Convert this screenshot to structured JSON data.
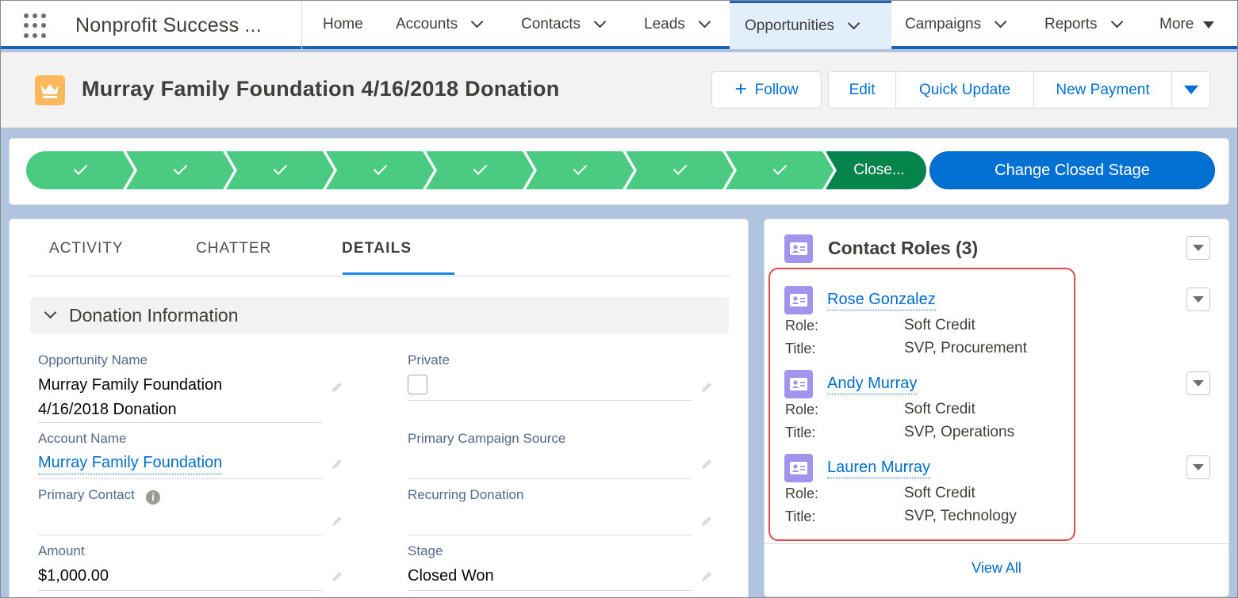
{
  "nav": {
    "app_name": "Nonprofit Success ...",
    "items": [
      {
        "label": "Home"
      },
      {
        "label": "Accounts"
      },
      {
        "label": "Contacts"
      },
      {
        "label": "Leads"
      },
      {
        "label": "Opportunities"
      },
      {
        "label": "Campaigns"
      },
      {
        "label": "Reports"
      },
      {
        "label": "More"
      }
    ],
    "active_item": "Opportunities"
  },
  "header": {
    "record_icon": "crown-icon",
    "title": "Murray Family Foundation 4/16/2018 Donation",
    "follow_label": "Follow",
    "actions": [
      "Edit",
      "Quick Update",
      "New Payment"
    ],
    "more_actions_icon": "dropdown-triangle-icon"
  },
  "path": {
    "completed_steps": 8,
    "current_step_label": "Close...",
    "change_stage_label": "Change Closed Stage",
    "colors": {
      "completed": "#4bca81",
      "current": "#04844b",
      "button": "#0070d2"
    }
  },
  "tabs": {
    "items": [
      "ACTIVITY",
      "CHATTER",
      "DETAILS"
    ],
    "active": "DETAILS"
  },
  "details": {
    "section_title": "Donation Information",
    "opportunity_name_label": "Opportunity Name",
    "opportunity_name_line1": "Murray Family Foundation",
    "opportunity_name_line2": "4/16/2018 Donation",
    "private_label": "Private",
    "private_checked": false,
    "account_name_label": "Account Name",
    "account_name_value": "Murray Family Foundation",
    "primary_campaign_label": "Primary Campaign Source",
    "primary_campaign_value": "",
    "primary_contact_label": "Primary Contact",
    "primary_contact_value": "",
    "recurring_donation_label": "Recurring Donation",
    "recurring_donation_value": "",
    "amount_label": "Amount",
    "amount_value": "$1,000.00",
    "stage_label": "Stage",
    "stage_value": "Closed Won"
  },
  "contact_roles": {
    "title": "Contact Roles (3)",
    "role_label": "Role:",
    "title_label": "Title:",
    "contacts": [
      {
        "name": "Rose Gonzalez",
        "role": "Soft Credit",
        "title": "SVP, Procurement"
      },
      {
        "name": "Andy Murray",
        "role": "Soft Credit",
        "title": "SVP, Operations"
      },
      {
        "name": "Lauren Murray",
        "role": "Soft Credit",
        "title": "SVP, Technology"
      }
    ],
    "view_all_label": "View All",
    "highlight_color": "#e04b4b"
  }
}
